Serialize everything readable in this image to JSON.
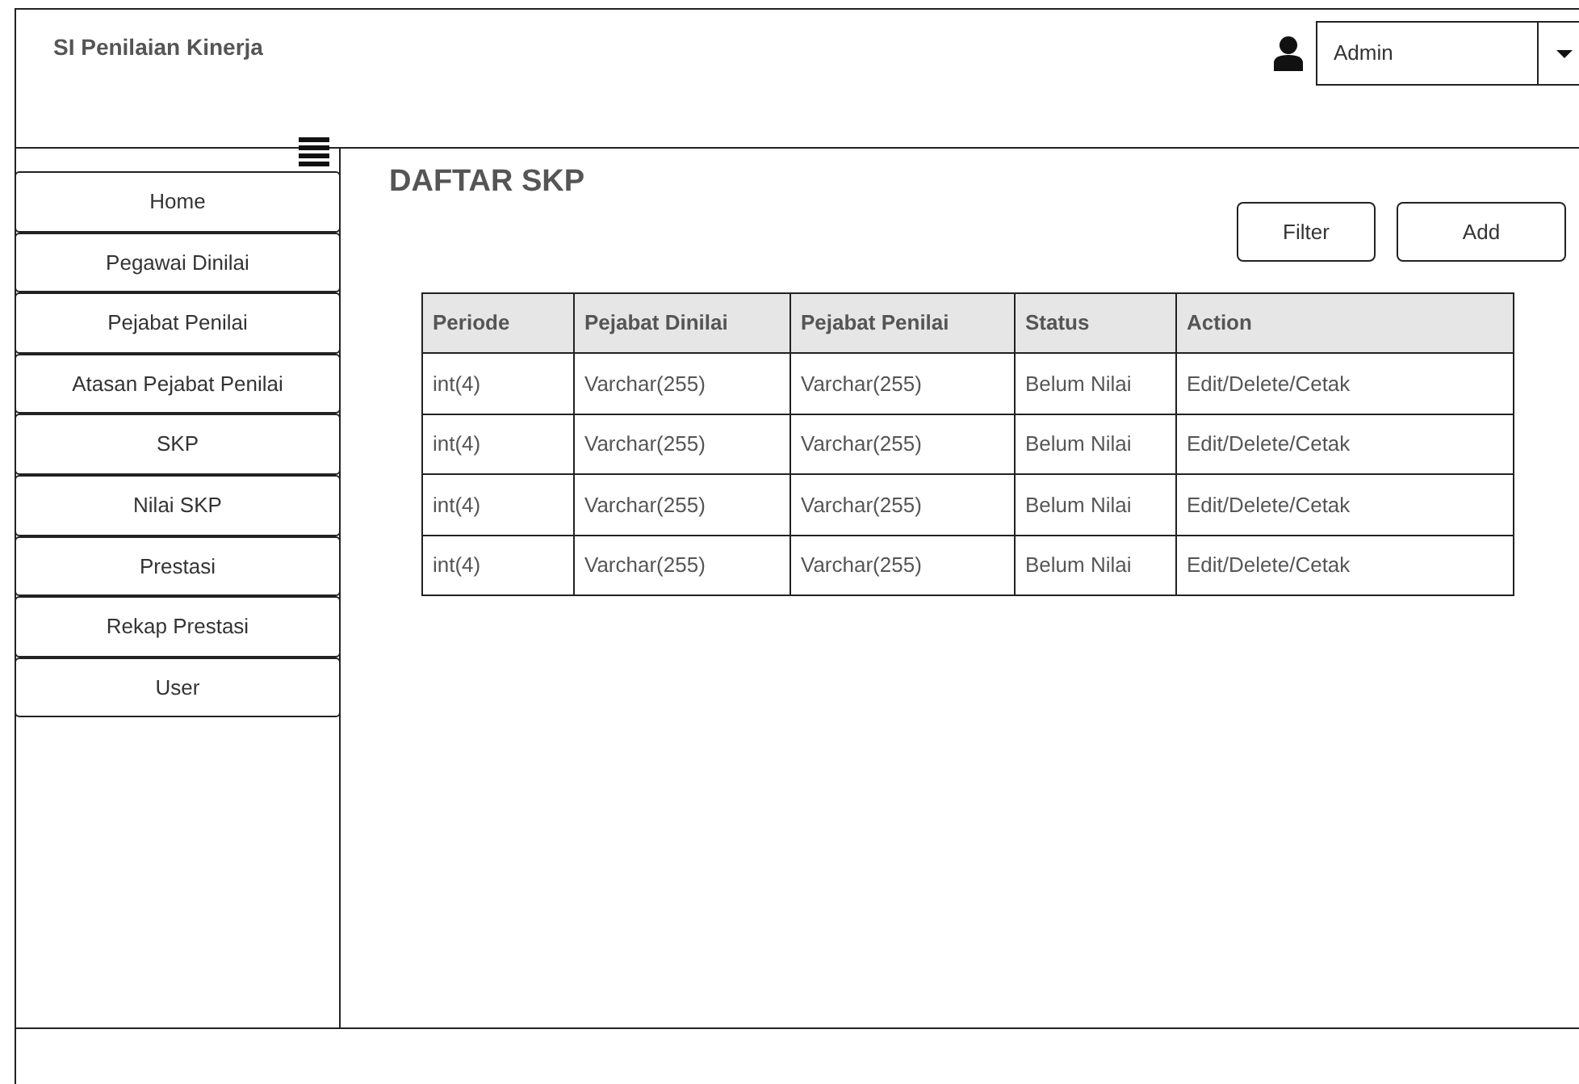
{
  "app_title": "SI Penilaian Kinerja",
  "user_select": {
    "value": "Admin"
  },
  "sidebar": {
    "items": [
      {
        "label": "Home"
      },
      {
        "label": "Pegawai Dinilai"
      },
      {
        "label": "Pejabat Penilai"
      },
      {
        "label": "Atasan Pejabat Penilai"
      },
      {
        "label": "SKP"
      },
      {
        "label": "Nilai SKP"
      },
      {
        "label": "Prestasi"
      },
      {
        "label": "Rekap Prestasi"
      },
      {
        "label": "User"
      }
    ]
  },
  "page_title": "DAFTAR SKP",
  "buttons": [
    "Filter",
    "Add"
  ],
  "table": {
    "columns": [
      "Periode",
      "Pejabat Dinilai",
      "Pejabat Penilai",
      "Status",
      "Action"
    ],
    "rows": [
      [
        "int(4)",
        "Varchar(255)",
        "Varchar(255)",
        "Belum Nilai",
        "Edit/Delete/Cetak"
      ],
      [
        "int(4)",
        "Varchar(255)",
        "Varchar(255)",
        "Belum Nilai",
        "Edit/Delete/Cetak"
      ],
      [
        "int(4)",
        "Varchar(255)",
        "Varchar(255)",
        "Belum Nilai",
        "Edit/Delete/Cetak"
      ],
      [
        "int(4)",
        "Varchar(255)",
        "Varchar(255)",
        "Belum Nilai",
        "Edit/Delete/Cetak"
      ]
    ]
  }
}
